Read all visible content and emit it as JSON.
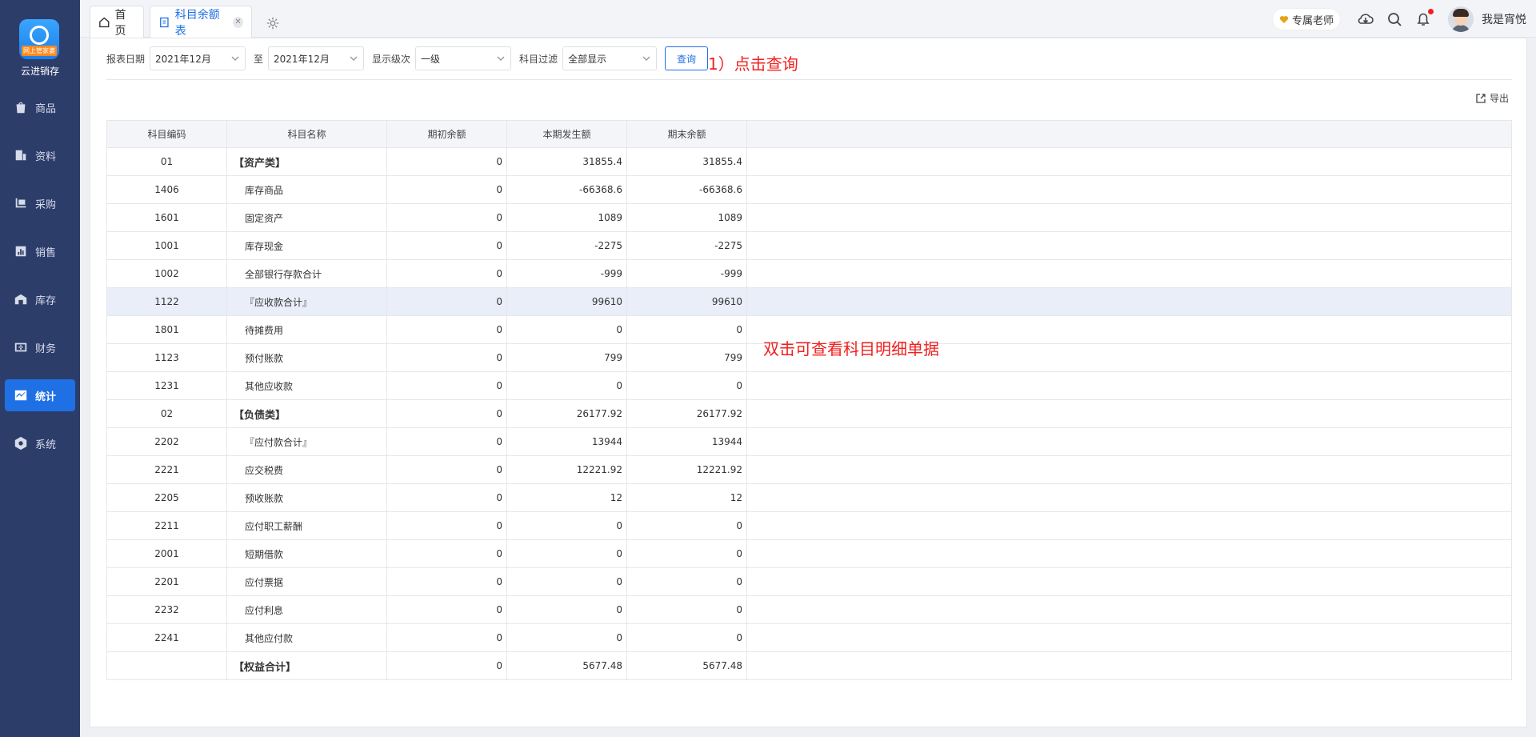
{
  "brand": {
    "ribbon": "网上管家婆",
    "name": "云进销存"
  },
  "nav": [
    {
      "label": "商品",
      "icon": "bag-icon"
    },
    {
      "label": "资料",
      "icon": "document-icon"
    },
    {
      "label": "采购",
      "icon": "purchase-icon"
    },
    {
      "label": "销售",
      "icon": "chart-icon"
    },
    {
      "label": "库存",
      "icon": "warehouse-icon"
    },
    {
      "label": "财务",
      "icon": "finance-icon"
    },
    {
      "label": "统计",
      "icon": "stats-icon",
      "active": true
    },
    {
      "label": "系统",
      "icon": "hexagon-icon"
    }
  ],
  "tabs": {
    "home": "首页",
    "current": "科目余额表"
  },
  "topbar": {
    "teacher": "专属老师",
    "username": "我是宵悦"
  },
  "filters": {
    "date_label": "报表日期",
    "date_from": "2021年12月",
    "to_label": "至",
    "date_to": "2021年12月",
    "level_label": "显示级次",
    "level": "一级",
    "filter_label": "科目过滤",
    "filter": "全部显示",
    "query_label": "查询"
  },
  "annotations": {
    "step1": "1）点击查询",
    "dblclick": "双击可查看科目明细单据"
  },
  "export_label": "导出",
  "table": {
    "headers": [
      "科目编码",
      "科目名称",
      "期初余额",
      "本期发生额",
      "期末余额"
    ],
    "rows": [
      {
        "code": "01",
        "name": "【资产类】",
        "open": "0",
        "change": "31855.4",
        "close": "31855.4",
        "group": true
      },
      {
        "code": "1406",
        "name": "库存商品",
        "open": "0",
        "change": "-66368.6",
        "close": "-66368.6"
      },
      {
        "code": "1601",
        "name": "固定资产",
        "open": "0",
        "change": "1089",
        "close": "1089"
      },
      {
        "code": "1001",
        "name": "库存现金",
        "open": "0",
        "change": "-2275",
        "close": "-2275"
      },
      {
        "code": "1002",
        "name": "全部银行存款合计",
        "open": "0",
        "change": "-999",
        "close": "-999"
      },
      {
        "code": "1122",
        "name": "『应收款合计』",
        "open": "0",
        "change": "99610",
        "close": "99610",
        "highlight": true
      },
      {
        "code": "1801",
        "name": "待摊费用",
        "open": "0",
        "change": "0",
        "close": "0"
      },
      {
        "code": "1123",
        "name": "预付账款",
        "open": "0",
        "change": "799",
        "close": "799"
      },
      {
        "code": "1231",
        "name": "其他应收款",
        "open": "0",
        "change": "0",
        "close": "0"
      },
      {
        "code": "02",
        "name": "【负债类】",
        "open": "0",
        "change": "26177.92",
        "close": "26177.92",
        "group": true
      },
      {
        "code": "2202",
        "name": "『应付款合计』",
        "open": "0",
        "change": "13944",
        "close": "13944"
      },
      {
        "code": "2221",
        "name": "应交税费",
        "open": "0",
        "change": "12221.92",
        "close": "12221.92"
      },
      {
        "code": "2205",
        "name": "预收账款",
        "open": "0",
        "change": "12",
        "close": "12"
      },
      {
        "code": "2211",
        "name": "应付职工薪酬",
        "open": "0",
        "change": "0",
        "close": "0"
      },
      {
        "code": "2001",
        "name": "短期借款",
        "open": "0",
        "change": "0",
        "close": "0"
      },
      {
        "code": "2201",
        "name": "应付票据",
        "open": "0",
        "change": "0",
        "close": "0"
      },
      {
        "code": "2232",
        "name": "应付利息",
        "open": "0",
        "change": "0",
        "close": "0"
      },
      {
        "code": "2241",
        "name": "其他应付款",
        "open": "0",
        "change": "0",
        "close": "0"
      },
      {
        "code": "",
        "name": "【权益合计】",
        "open": "0",
        "change": "5677.48",
        "close": "5677.48",
        "group": true
      }
    ]
  },
  "colors": {
    "sidebar": "#2d3d6a",
    "accent": "#1f6fe5",
    "annotation": "#f0201f",
    "highlight_row": "#e9eef9"
  }
}
